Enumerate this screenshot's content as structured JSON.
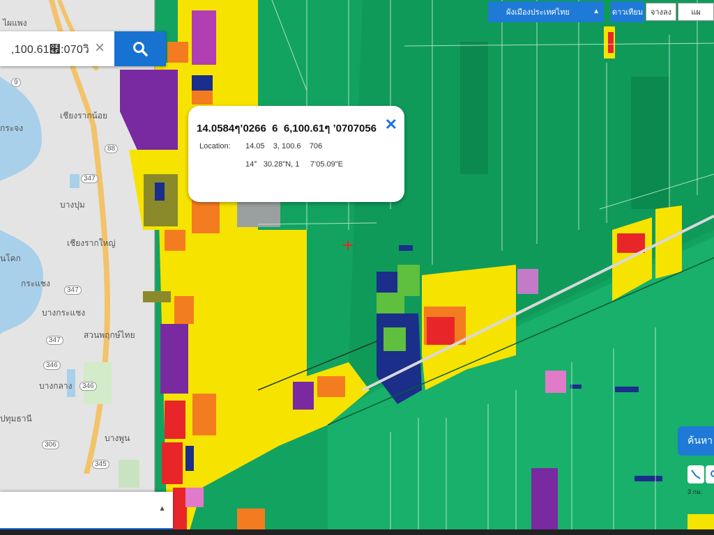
{
  "search": {
    "value": ",100.61๯:070วิ"
  },
  "popup": {
    "title": "14.0584ๆ’0266 6 6,100.61ๆ ’0707056",
    "location_label": "Location:",
    "coords_decimal": "14.05    3, 100.6    706",
    "coords_dms": "14°   30.28\"N, 1     7’05.09\"E"
  },
  "layer_select": {
    "value": "ผังเมืองประเทศไทย"
  },
  "toggle": {
    "label": "ดาวเทียม",
    "option_left": "จางลง",
    "option_right": "แผ"
  },
  "side_button": {
    "label": "ค้นหา"
  },
  "scale_text": "3 กม.",
  "map_labels": [
    {
      "text": "ไผแพง"
    },
    {
      "text": "347"
    },
    {
      "text": "9"
    },
    {
      "text": "เชียงรากน้อย"
    },
    {
      "text": "กระจง"
    },
    {
      "text": "บางปุม"
    },
    {
      "text": "เชียงรากใหญ่"
    },
    {
      "text": "นโคก"
    },
    {
      "text": "กระแชง"
    },
    {
      "text": "347"
    },
    {
      "text": "บางกระแชง"
    },
    {
      "text": "สวนพฤกษ์ไทย"
    },
    {
      "text": "346"
    },
    {
      "text": "บางกลาง"
    },
    {
      "text": "ปทุมธานี"
    },
    {
      "text": "306"
    },
    {
      "text": "บางพูน"
    },
    {
      "text": "345"
    },
    {
      "text": "88"
    }
  ],
  "colors": {
    "agri_green": "#12a360",
    "dark_green": "#0a7f46",
    "residential_yellow": "#f7e300",
    "commercial_red": "#e8262a",
    "orange": "#f47c20",
    "purple": "#7a2aa0",
    "magenta": "#b13fb3",
    "blue": "#1a2e8a",
    "pink": "#e07ac9",
    "ui_blue": "#1e7ad6",
    "basemap_gray": "#e4e4e4"
  }
}
